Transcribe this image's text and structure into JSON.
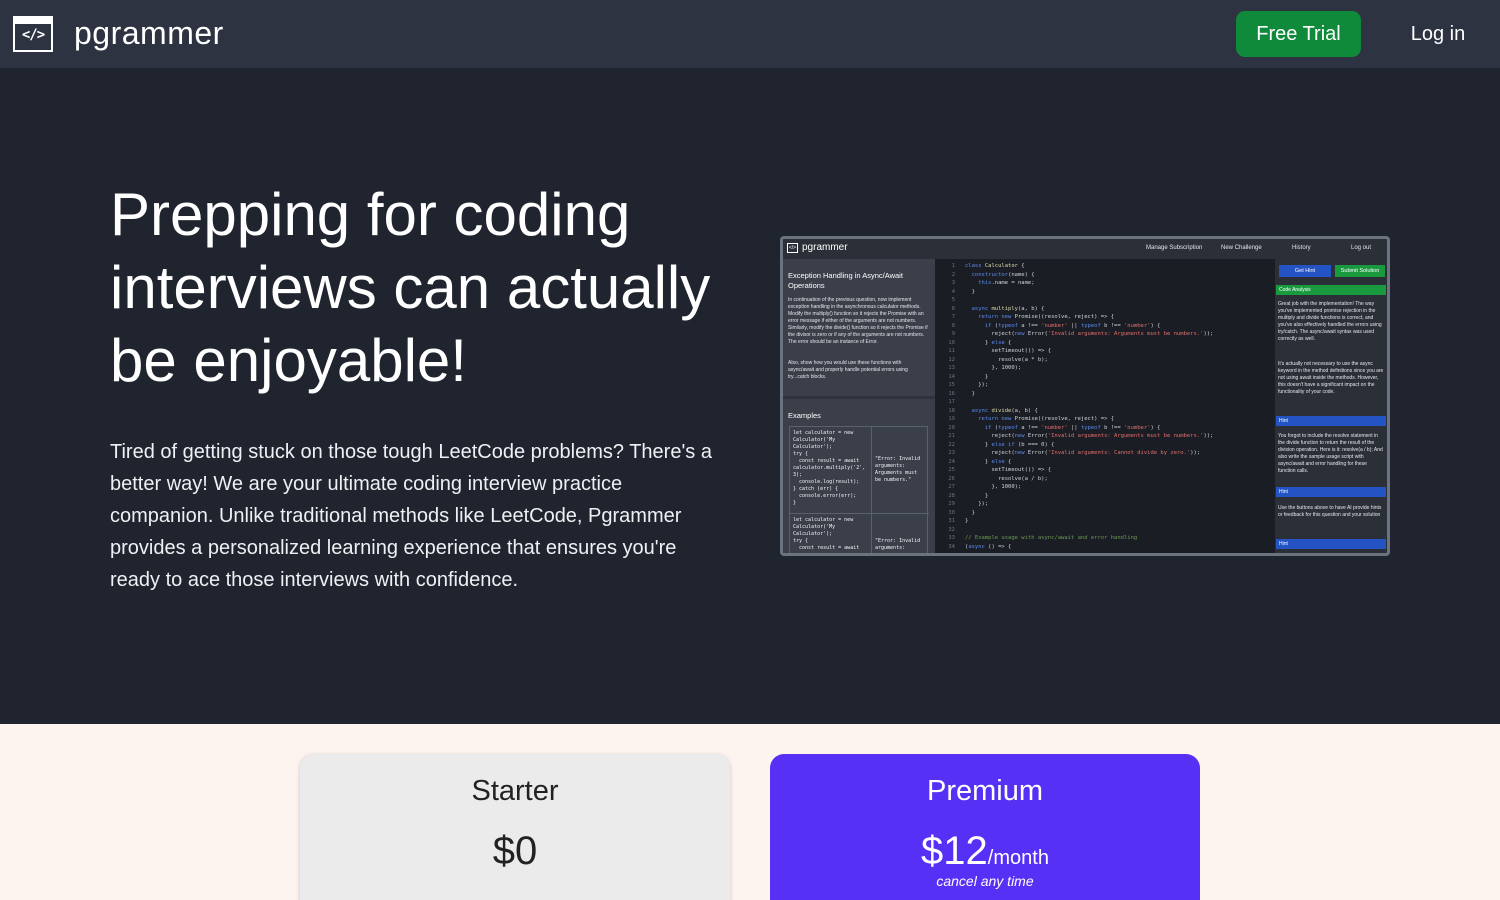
{
  "header": {
    "logo_glyph": "</>",
    "brand": "pgrammer",
    "free_trial_label": "Free Trial",
    "login_label": "Log in",
    "free_trial_color": "#0f8a3b"
  },
  "hero": {
    "title": "Prepping for coding interviews can actually be enjoyable!",
    "description": "Tired of getting stuck on those tough LeetCode problems? There's a better way! We are your ultimate coding interview practice companion. Unlike traditional methods like LeetCode, Pgrammer provides a personalized learning experience that ensures you're ready to ace those interviews with confidence."
  },
  "screenshot": {
    "brand": "pgrammer",
    "nav": [
      "Manage Subscription",
      "New Challenge",
      "History",
      "Log out"
    ],
    "problem_title": "Exception Handling in Async/Await Operations",
    "problem_text": "In continuation of the previous question, now implement exception handling in the asynchronous calculator methods. Modify the multiply() function so it rejects the Promise with an error message if either of the arguments are not numbers. Similarly, modify the divide() function so it rejects the Promise if the divisor is zero or if any of the arguments are not numbers. The error should be an instance of Error.",
    "problem_text2": "Also, show how you would use these functions with async/await and properly handle potential errors using try...catch blocks.",
    "examples_label": "Examples",
    "example1_code": "let calculator = new\nCalculator('My\nCalculator');\ntry {\n  const result = await\ncalculator.multiply('2',\n3);\n  console.log(result);\n} catch (err) {\n  console.error(err);\n}",
    "example1_output": "\"Error: Invalid\narguments:\nArguments must\nbe numbers.\"",
    "example2_code": "let calculator = new\nCalculator('My\nCalculator');\ntry {\n  const result = await",
    "example2_output": "\"Error: Invalid\narguments:",
    "get_hint_label": "Get Hint",
    "submit_label": "Submit Solution",
    "code_analysis_label": "Code Analysis",
    "analysis_text1": "Great job with the implementation! The way you've implemented promise rejection in the multiply and divide functions is correct, and you've also effectively handled the errors using try/catch. The async/await syntax was used correctly as well.",
    "analysis_text2": "It's actually not necessary to use the async keyword in the method definitions since you are not using await inside the methods. However, this doesn't have a significant impact on the functionality of your code.",
    "hint_label": "Hint",
    "hint_text1": "You forgot to include the resolve statement in the divide function to return the result of the division operation. Here is it: resolve(a / b); And also write the sample usage script with async/await and error handling for these function calls.",
    "hint_text2": "Use the buttons above to have AI provide hints or feedback for this question and your solution"
  },
  "pricing": {
    "starter": {
      "title": "Starter",
      "price": "$0"
    },
    "premium": {
      "title": "Premium",
      "price": "$12",
      "period": "/month",
      "note": "cancel any time",
      "color": "#5631f5"
    }
  }
}
